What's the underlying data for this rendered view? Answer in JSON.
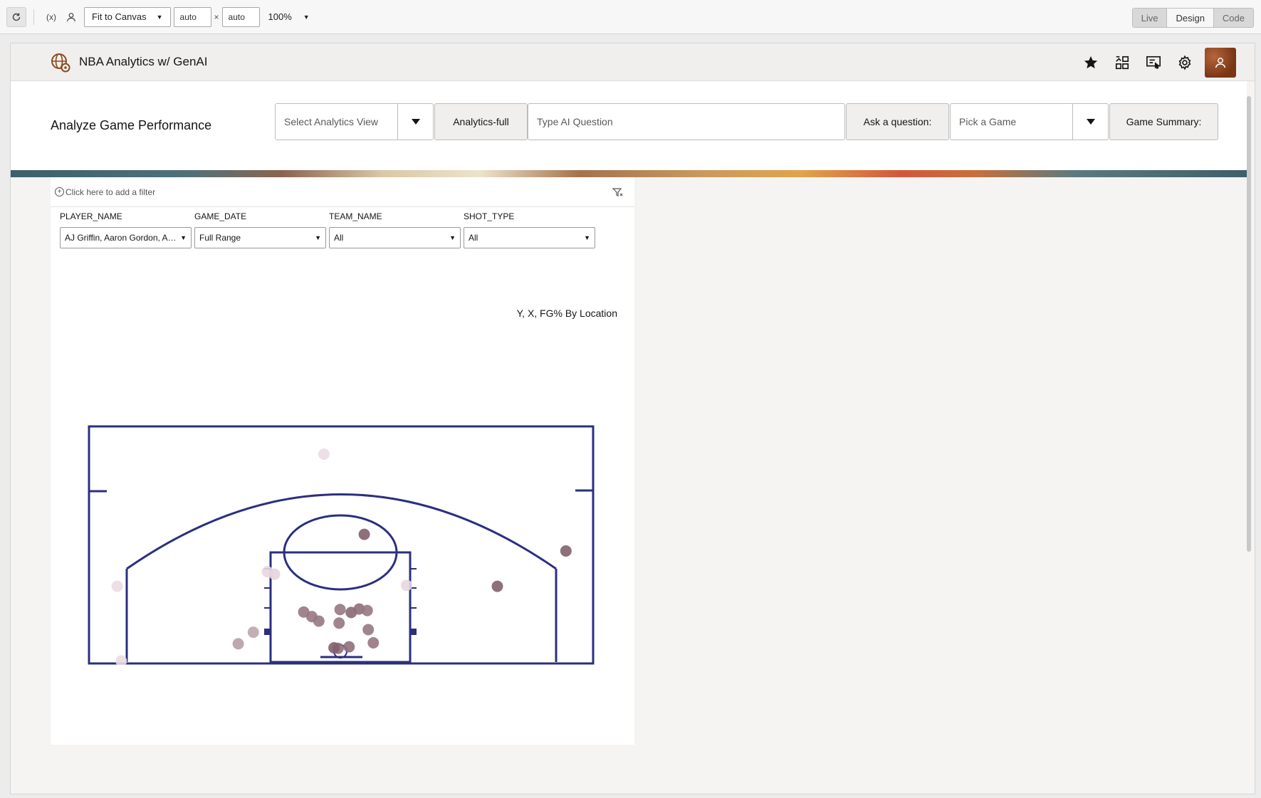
{
  "toolbar": {
    "fit_label": "Fit to Canvas",
    "width_value": "auto",
    "height_value": "auto",
    "times_symbol": "×",
    "zoom_label": "100%",
    "modes": [
      "Live",
      "Design",
      "Code"
    ]
  },
  "app": {
    "title": "NBA Analytics w/ GenAI",
    "header_icons": [
      "star-icon",
      "layout-icon",
      "presentation-icon",
      "gear-icon",
      "user-icon"
    ]
  },
  "page": {
    "title": "Analyze Game Performance",
    "analytics_view_placeholder": "Select Analytics View",
    "analytics_button": "Analytics-full",
    "ai_question_placeholder": "Type AI Question",
    "ask_button": "Ask a question:",
    "game_placeholder": "Pick a Game",
    "summary_button": "Game Summary:"
  },
  "viz": {
    "add_filter_label": "Click here to add a filter",
    "filters": [
      {
        "label": "PLAYER_NAME",
        "value": "AJ Griffin, Aaron Gordon, Aaron Holiday"
      },
      {
        "label": "GAME_DATE",
        "value": "Full Range"
      },
      {
        "label": "TEAM_NAME",
        "value": "All"
      },
      {
        "label": "SHOT_TYPE",
        "value": "All"
      }
    ],
    "title": "Y, X, FG% By Location",
    "court_color": "#2b2f7f",
    "shot_color_hi": "#6e4a55",
    "shot_color_lo": "#f2e3ea"
  },
  "chart_data": {
    "type": "scatter",
    "title": "Y, X, FG% By Location",
    "xlabel": "",
    "ylabel": "",
    "note": "shot locations on half-court; fg = FG% shade (0 light .. 1 dark); x in feet from basket (-25..25), y in feet from baseline (0..47)",
    "points": [
      {
        "x": -1.7,
        "y": 41.5,
        "fg": 0.05
      },
      {
        "x": 2.3,
        "y": 25.6,
        "fg": 0.85
      },
      {
        "x": 22.3,
        "y": 22.3,
        "fg": 0.85
      },
      {
        "x": 15.5,
        "y": 15.3,
        "fg": 0.85
      },
      {
        "x": -7.3,
        "y": 18.2,
        "fg": 0.08
      },
      {
        "x": -6.6,
        "y": 17.7,
        "fg": 0.1
      },
      {
        "x": 6.5,
        "y": 15.5,
        "fg": 0.08
      },
      {
        "x": -22.2,
        "y": 15.3,
        "fg": 0.05
      },
      {
        "x": -21.8,
        "y": 0.5,
        "fg": 0.05
      },
      {
        "x": -10.2,
        "y": 3.9,
        "fg": 0.45
      },
      {
        "x": -8.7,
        "y": 6.2,
        "fg": 0.4
      },
      {
        "x": -2.9,
        "y": 9.3,
        "fg": 0.7
      },
      {
        "x": -2.2,
        "y": 8.4,
        "fg": 0.7
      },
      {
        "x": -0.1,
        "y": 10.7,
        "fg": 0.7
      },
      {
        "x": 1.0,
        "y": 10.1,
        "fg": 0.8
      },
      {
        "x": 1.8,
        "y": 10.8,
        "fg": 0.75
      },
      {
        "x": 2.6,
        "y": 10.5,
        "fg": 0.7
      },
      {
        "x": 2.7,
        "y": 6.7,
        "fg": 0.7
      },
      {
        "x": 3.2,
        "y": 4.1,
        "fg": 0.7
      },
      {
        "x": -0.3,
        "y": 3.0,
        "fg": 0.75
      },
      {
        "x": 0.8,
        "y": 3.3,
        "fg": 0.75
      },
      {
        "x": -0.7,
        "y": 3.1,
        "fg": 0.85
      },
      {
        "x": -0.2,
        "y": 8.0,
        "fg": 0.7
      },
      {
        "x": -3.7,
        "y": 10.2,
        "fg": 0.7
      }
    ]
  }
}
